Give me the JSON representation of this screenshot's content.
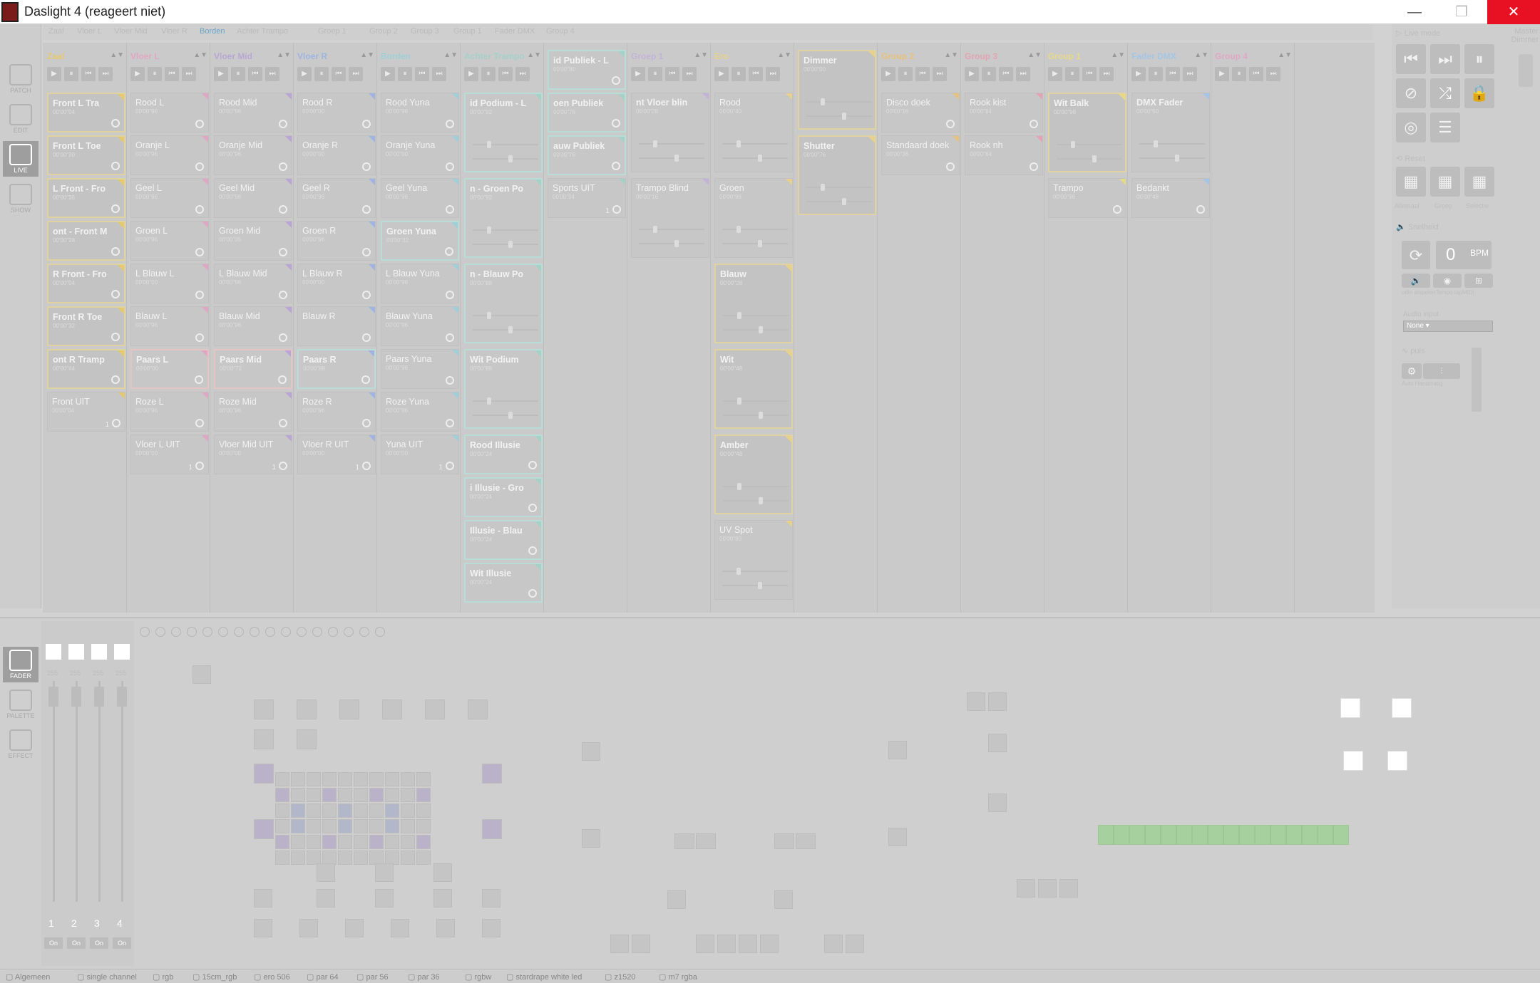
{
  "window": {
    "title": "Daslight 4 (reageert niet)",
    "min": "—",
    "max": "❐",
    "close": "✕"
  },
  "leftnav": [
    {
      "label": "PATCH"
    },
    {
      "label": "EDIT"
    },
    {
      "label": "LIVE"
    },
    {
      "label": "SHOW"
    }
  ],
  "bottomnav": [
    {
      "label": "FADER"
    },
    {
      "label": "PALETTE"
    },
    {
      "label": "EFFECT"
    }
  ],
  "tabs": [
    "Zaal",
    "Vloer L",
    "Vloer Mid",
    "Vloer R",
    "Borden",
    "Achter Trampo",
    "Groep 1",
    "Group 2",
    "Group 3",
    "Group 1",
    "Fader DMX",
    "Group 4"
  ],
  "active_tab": "Borden",
  "columns": [
    {
      "title": "Zaal",
      "color": "#e6c86e",
      "cards": [
        {
          "name": "Front L Tra",
          "time": "00'00\"04",
          "state": "active"
        },
        {
          "name": "Front L Toe",
          "time": "00'00\"30",
          "state": "active"
        },
        {
          "name": "L Front - Fro",
          "time": "00'00\"36",
          "state": "active"
        },
        {
          "name": "ont - Front M",
          "time": "00'00\"28",
          "state": "active"
        },
        {
          "name": "R Front - Fro",
          "time": "00'00\"04",
          "state": "active"
        },
        {
          "name": "Front R Toe",
          "time": "00'00\"32",
          "state": "active"
        },
        {
          "name": "ont R Tramp",
          "time": "00'00\"44",
          "state": "active"
        },
        {
          "name": "Front UIT",
          "time": "00'00\"04",
          "state": "off",
          "count": "1"
        }
      ]
    },
    {
      "title": "Vloer L",
      "color": "#e0a7c4",
      "cards": [
        {
          "name": "Rood L",
          "time": "00'00\"96"
        },
        {
          "name": "Oranje L",
          "time": "00'00\"96"
        },
        {
          "name": "Geel L",
          "time": "00'00\"96"
        },
        {
          "name": "Groen L",
          "time": "00'00\"96"
        },
        {
          "name": "L Blauw L",
          "time": "00'00\"00"
        },
        {
          "name": "Blauw L",
          "time": "00'00\"96"
        },
        {
          "name": "Paars L",
          "time": "00'00\"00",
          "state": "pink"
        },
        {
          "name": "Roze L",
          "time": "00'00\"96"
        },
        {
          "name": "Vloer L UIT",
          "time": "00'00\"00",
          "count": "1"
        }
      ]
    },
    {
      "title": "Vloer Mid",
      "color": "#b9a6d6",
      "cards": [
        {
          "name": "Rood Mid",
          "time": "00'00\"96"
        },
        {
          "name": "Oranje Mid",
          "time": "00'00\"96"
        },
        {
          "name": "Geel Mid",
          "time": "00'00\"96"
        },
        {
          "name": "Groen Mid",
          "time": "00'00\"05"
        },
        {
          "name": "L Blauw Mid",
          "time": "00'00\"96"
        },
        {
          "name": "Blauw Mid",
          "time": "00'00\"96"
        },
        {
          "name": "Paars Mid",
          "time": "00'00\"72",
          "state": "pink"
        },
        {
          "name": "Roze Mid",
          "time": "00'00\"96"
        },
        {
          "name": "Vloer Mid UIT",
          "time": "00'00\"00",
          "count": "1"
        }
      ]
    },
    {
      "title": "Vloer R",
      "color": "#9fb4e0",
      "cards": [
        {
          "name": "Rood R",
          "time": "00'00\"00"
        },
        {
          "name": "Oranje R",
          "time": "00'00\"00"
        },
        {
          "name": "Geel R",
          "time": "00'00\"96"
        },
        {
          "name": "Groen R",
          "time": "00'00\"96"
        },
        {
          "name": "L Blauw R",
          "time": "00'00\"00"
        },
        {
          "name": "Blauw R",
          "time": ""
        },
        {
          "name": "Paars R",
          "time": "00'00\"88",
          "state": "selected"
        },
        {
          "name": "Roze R",
          "time": "00'00\"96"
        },
        {
          "name": "Vloer R UIT",
          "time": "00'00\"00",
          "count": "1"
        }
      ]
    },
    {
      "title": "Borden",
      "color": "#9fd0d8",
      "cards": [
        {
          "name": "Rood Yuna",
          "time": "00'00\"96"
        },
        {
          "name": "Oranje Yuna",
          "time": "00'00\"00"
        },
        {
          "name": "Geel Yuna",
          "time": "00'00\"96"
        },
        {
          "name": "Groen Yuna",
          "time": "00'00\"32",
          "state": "cyan"
        },
        {
          "name": "L Blauw Yuna",
          "time": "00'00\"96"
        },
        {
          "name": "Blauw Yuna",
          "time": "00'00\"96"
        },
        {
          "name": "Paars Yuna",
          "time": "00'00\"96"
        },
        {
          "name": "Roze Yuna",
          "time": "00'00\"96"
        },
        {
          "name": "Yuna UIT",
          "time": "00'00\"00",
          "count": "1"
        }
      ]
    },
    {
      "title": "Achter Trampo",
      "color": "#a5d1c8",
      "cards": [
        {
          "name": "id Podium - L",
          "time": "00'00\"92",
          "state": "cyan",
          "tall": true
        },
        {
          "name": "n - Groen Po",
          "time": "00'00\"92",
          "state": "cyan",
          "tall": true
        },
        {
          "name": "n - Blauw Po",
          "time": "00'00\"88",
          "state": "cyan",
          "tall": true
        },
        {
          "name": "Wit Podium",
          "time": "00'00\"88",
          "state": "cyan",
          "tall": true
        },
        {
          "name": "Rood Illusie",
          "time": "00'00\"24",
          "state": "cyan"
        },
        {
          "name": "i Illusie - Gro",
          "time": "00'00\"24",
          "state": "cyan"
        },
        {
          "name": "Illusie - Blau",
          "time": "00'00\"24",
          "state": "cyan"
        },
        {
          "name": "Wit Illusie",
          "time": "00'00\"24",
          "state": "cyan"
        }
      ]
    },
    {
      "title": "",
      "color": "#a5d1c8",
      "cards": [
        {
          "name": "id Publiek - L",
          "time": "00'00\"80",
          "state": "cyan"
        },
        {
          "name": "oen Publiek",
          "time": "00'00\"76",
          "state": "cyan"
        },
        {
          "name": "auw Publiek",
          "time": "00'00\"76",
          "state": "cyan"
        },
        {
          "name": "Sports UIT",
          "time": "00'00\"04",
          "count": "1"
        }
      ]
    },
    {
      "title": "Groep 1",
      "color": "#c3b3d8",
      "cards": [
        {
          "name": "nt Vloer blin",
          "time": "00'00\"28",
          "state": "plain",
          "tall": true
        },
        {
          "name": "Trampo Blind",
          "time": "00'00\"16",
          "tall": true
        }
      ]
    },
    {
      "title": "Ero",
      "color": "#e6d28a",
      "cards": [
        {
          "name": "Rood",
          "time": "00'00\"40",
          "tall": true
        },
        {
          "name": "Groen",
          "time": "00'00\"96",
          "tall": true
        },
        {
          "name": "Blauw",
          "time": "00'00\"28",
          "state": "active",
          "tall": true
        },
        {
          "name": "Wit",
          "time": "00'00\"48",
          "state": "active",
          "tall": true
        },
        {
          "name": "Amber",
          "time": "00'00\"48",
          "state": "active",
          "tall": true
        },
        {
          "name": "UV Spot",
          "time": "00'00\"80",
          "tall": true
        }
      ]
    },
    {
      "title": "",
      "color": "#e6d28a",
      "cards": [
        {
          "name": "Dimmer",
          "time": "00'00\"00",
          "state": "active",
          "tall": true
        },
        {
          "name": "Shutter",
          "time": "00'00\"76",
          "state": "active",
          "tall": true
        }
      ]
    },
    {
      "title": "Group 2",
      "color": "#e6c27c",
      "cards": [
        {
          "name": "Disco doek",
          "time": "00'00\"16"
        },
        {
          "name": "Standaard doek",
          "time": "00'00\"36"
        }
      ]
    },
    {
      "title": "Group 3",
      "color": "#e3a3b4",
      "cards": [
        {
          "name": "Rook kist",
          "time": "00'00\"84"
        },
        {
          "name": "Rook nh",
          "time": "00'00\"64"
        }
      ]
    },
    {
      "title": "Group 1",
      "color": "#e6da86",
      "cards": [
        {
          "name": "Wit Balk",
          "time": "00'00\"96",
          "state": "active",
          "tall": true
        },
        {
          "name": "Trampo",
          "time": "00'00\"96"
        }
      ]
    },
    {
      "title": "Fader DMX",
      "color": "#a3c6e6",
      "cards": [
        {
          "name": "DMX Fader",
          "time": "00'00\"50",
          "state": "plain",
          "tall": true
        },
        {
          "name": "Bedankt",
          "time": "00'00\"48"
        }
      ]
    },
    {
      "title": "Group 4",
      "color": "#e0a7c4",
      "cards": []
    }
  ],
  "rightpanel": {
    "live_mode": "Live mode",
    "reset": "Reset",
    "alles": "Allemaal",
    "groep": "Groep",
    "select": "Selectie",
    "snelheid": "Snelheid",
    "bpm_value": "0",
    "bpm_unit": "BPM",
    "audio_row": "udio afspelenTempo tapMIDI",
    "audio_input_label": "Audio input",
    "audio_input_value": "None",
    "puls": "puls",
    "auto": "Auto Handmatig",
    "master": "Master Dimmer"
  },
  "faders": [
    {
      "num": "1",
      "val": "255",
      "on": "On"
    },
    {
      "num": "2",
      "val": "255",
      "on": "On"
    },
    {
      "num": "3",
      "val": "255",
      "on": "On"
    },
    {
      "num": "4",
      "val": "255",
      "on": "On"
    }
  ],
  "statusbar": [
    "Algemeen",
    "single channel",
    "rgb",
    "15cm_rgb",
    "ero 506",
    "par 64",
    "par 56",
    "par 36",
    "rgbw",
    "stardrape white led",
    "z1520",
    "m7 rgba"
  ]
}
